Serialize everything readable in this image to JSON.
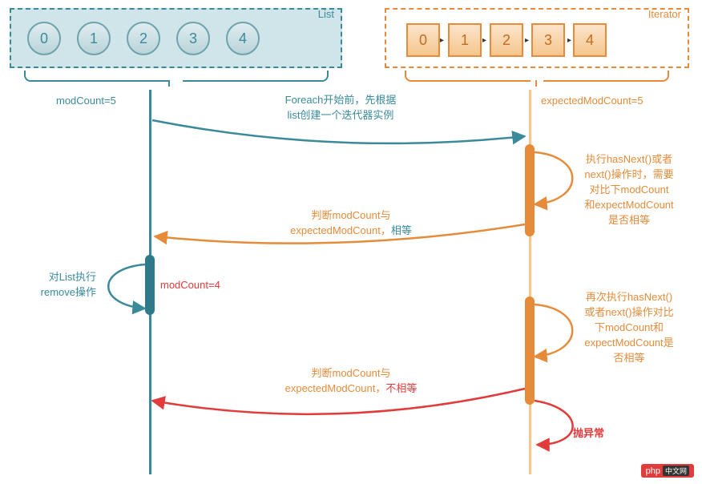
{
  "list": {
    "title": "List",
    "items": [
      "0",
      "1",
      "2",
      "3",
      "4"
    ],
    "modCountLabel": "modCount=5"
  },
  "iterator": {
    "title": "Iterator",
    "items": [
      "0",
      "1",
      "2",
      "3",
      "4"
    ],
    "expectedLabel": "expectedModCount=5"
  },
  "messages": {
    "create": {
      "line1": "Foreach开始前，先根据",
      "line2": "list创建一个迭代器实例"
    },
    "check1": {
      "line1": "执行hasNext()或者",
      "line2": "next()操作时，需要",
      "line3": "对比下modCount",
      "line4": "和expectModCount",
      "line5": "是否相等"
    },
    "reply1": {
      "line1": "判断modCount与",
      "line2a": "expectedModCount，",
      "line2b": "相等"
    },
    "remove": {
      "line1": "对List执行",
      "line2": "remove操作"
    },
    "modCountAfter": "modCount=4",
    "check2": {
      "line1": "再次执行hasNext()",
      "line2": "或者next()操作对比",
      "line3": "下modCount和",
      "line4": "expectModCount是",
      "line5": "否相等"
    },
    "reply2": {
      "line1": "判断modCount与",
      "line2a": "expectedModCount，",
      "line2b": "不相等"
    },
    "exception": "抛异常"
  },
  "watermark": {
    "brand": "php",
    "suffix": "中文网"
  }
}
